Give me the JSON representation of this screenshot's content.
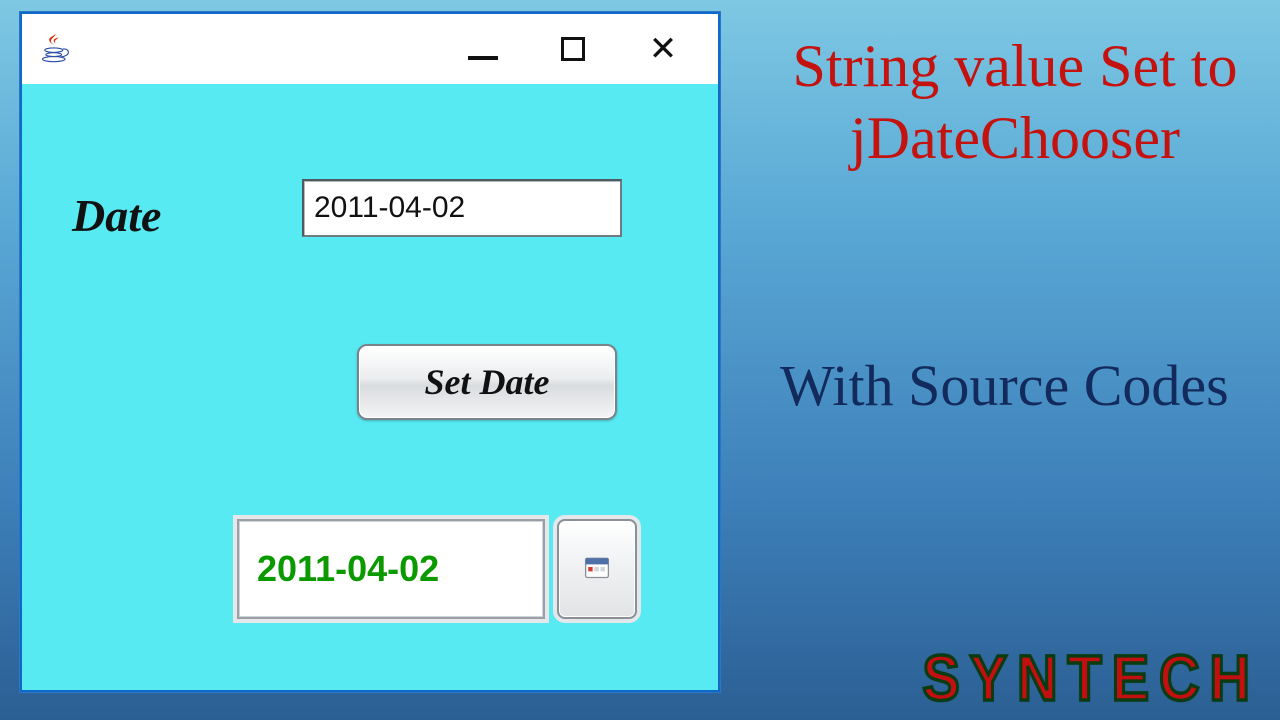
{
  "window": {
    "title": ""
  },
  "form": {
    "date_label": "Date",
    "date_value": "2011-04-02",
    "set_button_label": "Set Date",
    "chosen_date": "2011-04-02"
  },
  "overlay": {
    "headline_red": "String value Set to jDateChooser",
    "headline_blue": "With Source Codes",
    "brand": "SYNTECH"
  },
  "icons": {
    "app": "java-cup-icon",
    "minimize": "minimize-icon",
    "maximize": "maximize-icon",
    "close": "close-icon",
    "calendar": "calendar-icon"
  }
}
